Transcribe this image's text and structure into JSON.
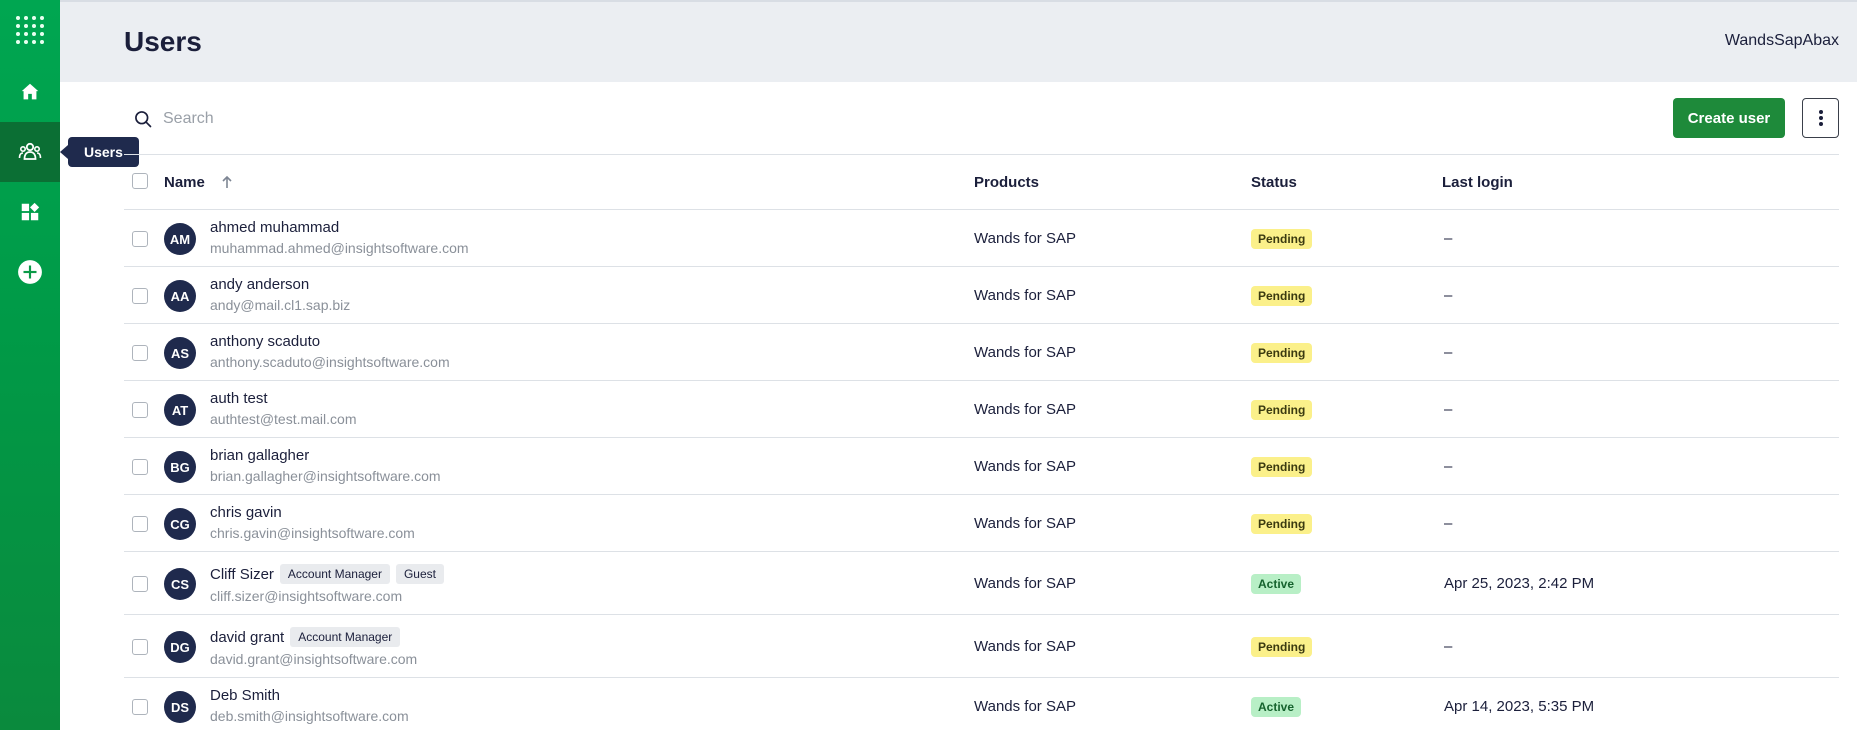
{
  "sidebar": {
    "items": [
      {
        "name": "apps-grid-icon",
        "active": false
      },
      {
        "name": "home-icon",
        "active": false
      },
      {
        "name": "users-icon",
        "active": true
      },
      {
        "name": "widgets-icon",
        "active": false
      },
      {
        "name": "add-circle-icon",
        "active": false
      }
    ],
    "tooltip": "Users"
  },
  "header": {
    "title": "Users",
    "org": "WandsSapAbax"
  },
  "toolbar": {
    "search_placeholder": "Search",
    "search_icon": "search-icon",
    "create_label": "Create user",
    "more_icon": "more-vertical-icon"
  },
  "table": {
    "columns": {
      "name": "Name",
      "products": "Products",
      "status": "Status",
      "last_login": "Last login"
    },
    "sort_icon": "arrow-up-icon",
    "rows": [
      {
        "initials": "AM",
        "name": "ahmed muhammad",
        "email": "muhammad.ahmed@insightsoftware.com",
        "roles": [],
        "product": "Wands for SAP",
        "status": "Pending",
        "last_login": "–"
      },
      {
        "initials": "AA",
        "name": "andy anderson",
        "email": "andy@mail.cl1.sap.biz",
        "roles": [],
        "product": "Wands for SAP",
        "status": "Pending",
        "last_login": "–"
      },
      {
        "initials": "AS",
        "name": "anthony scaduto",
        "email": "anthony.scaduto@insightsoftware.com",
        "roles": [],
        "product": "Wands for SAP",
        "status": "Pending",
        "last_login": "–"
      },
      {
        "initials": "AT",
        "name": "auth test",
        "email": "authtest@test.mail.com",
        "roles": [],
        "product": "Wands for SAP",
        "status": "Pending",
        "last_login": "–"
      },
      {
        "initials": "BG",
        "name": "brian gallagher",
        "email": "brian.gallagher@insightsoftware.com",
        "roles": [],
        "product": "Wands for SAP",
        "status": "Pending",
        "last_login": "–"
      },
      {
        "initials": "CG",
        "name": "chris gavin",
        "email": "chris.gavin@insightsoftware.com",
        "roles": [],
        "product": "Wands for SAP",
        "status": "Pending",
        "last_login": "–"
      },
      {
        "initials": "CS",
        "name": "Cliff Sizer",
        "email": "cliff.sizer@insightsoftware.com",
        "roles": [
          "Account Manager",
          "Guest"
        ],
        "product": "Wands for SAP",
        "status": "Active",
        "last_login": "Apr 25, 2023, 2:42 PM"
      },
      {
        "initials": "DG",
        "name": "david grant",
        "email": "david.grant@insightsoftware.com",
        "roles": [
          "Account Manager"
        ],
        "product": "Wands for SAP",
        "status": "Pending",
        "last_login": "–"
      },
      {
        "initials": "DS",
        "name": "Deb Smith",
        "email": "deb.smith@insightsoftware.com",
        "roles": [],
        "product": "Wands for SAP",
        "status": "Active",
        "last_login": "Apr 14, 2023, 5:35 PM"
      }
    ]
  },
  "colors": {
    "sidebar": "#00a651",
    "sidebar_active": "#0b6f34",
    "primary_button": "#1e8a3a",
    "avatar": "#1f2a4d",
    "pending": "#fbf08a",
    "active": "#b8efc6"
  }
}
